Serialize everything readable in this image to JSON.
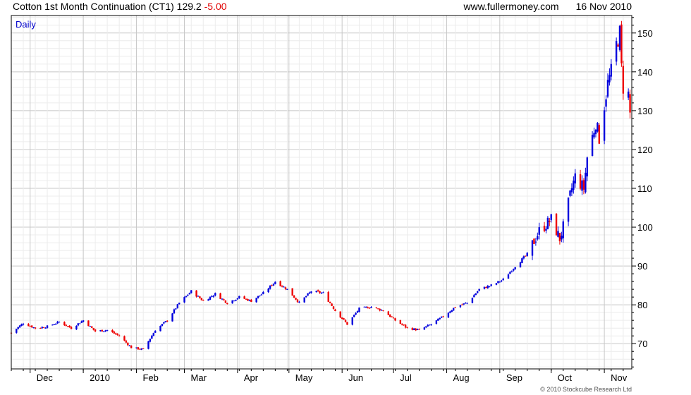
{
  "header": {
    "title": "Cotton 1st Month Continuation (CT1)",
    "last": "129.2",
    "change": "-5.00",
    "source": "www.fullermoney.com",
    "date": "16 Nov 2010"
  },
  "period_label": "Daily",
  "footer": {
    "copyright": "© 2010 Stockcube Research Ltd"
  },
  "colors": {
    "up": "#0000dd",
    "down": "#ee0000",
    "grid": "#d0d0d0",
    "frame": "#000000"
  },
  "chart_data": {
    "type": "candlestick",
    "x_range": [
      "2009-11-20",
      "2010-11-17"
    ],
    "ylim": [
      63.5,
      154.5
    ],
    "y_ticks": [
      70,
      80,
      90,
      100,
      110,
      120,
      130,
      140,
      150
    ],
    "x_ticks": [
      {
        "label": "Dec",
        "date": "2009-12-01"
      },
      {
        "label": "2010",
        "date": "2010-01-01"
      },
      {
        "label": "Feb",
        "date": "2010-02-01"
      },
      {
        "label": "Mar",
        "date": "2010-03-01"
      },
      {
        "label": "Apr",
        "date": "2010-04-01"
      },
      {
        "label": "May",
        "date": "2010-05-01"
      },
      {
        "label": "Jun",
        "date": "2010-06-01"
      },
      {
        "label": "Jul",
        "date": "2010-07-01"
      },
      {
        "label": "Aug",
        "date": "2010-08-01"
      },
      {
        "label": "Sep",
        "date": "2010-09-01"
      },
      {
        "label": "Oct",
        "date": "2010-10-01"
      },
      {
        "label": "Nov",
        "date": "2010-11-01"
      }
    ],
    "close_series": [
      [
        "2009-11-20",
        72.8
      ],
      [
        "2009-11-27",
        75.3
      ],
      [
        "2009-12-04",
        74.0
      ],
      [
        "2009-12-11",
        74.4
      ],
      [
        "2009-12-18",
        75.6
      ],
      [
        "2009-12-25",
        74.0
      ],
      [
        "2010-01-01",
        76.0
      ],
      [
        "2010-01-08",
        73.2
      ],
      [
        "2010-01-15",
        73.5
      ],
      [
        "2010-01-22",
        72.0
      ],
      [
        "2010-01-29",
        69.0
      ],
      [
        "2010-02-05",
        68.5
      ],
      [
        "2010-02-12",
        73.5
      ],
      [
        "2010-02-19",
        76.0
      ],
      [
        "2010-02-26",
        80.5
      ],
      [
        "2010-03-05",
        83.5
      ],
      [
        "2010-03-12",
        81.0
      ],
      [
        "2010-03-19",
        82.8
      ],
      [
        "2010-03-26",
        80.5
      ],
      [
        "2010-04-02",
        82.0
      ],
      [
        "2010-04-09",
        81.0
      ],
      [
        "2010-04-16",
        83.0
      ],
      [
        "2010-04-23",
        86.0
      ],
      [
        "2010-04-30",
        84.0
      ],
      [
        "2010-05-07",
        80.5
      ],
      [
        "2010-05-14",
        83.5
      ],
      [
        "2010-05-21",
        83.0
      ],
      [
        "2010-05-28",
        78.5
      ],
      [
        "2010-06-04",
        75.0
      ],
      [
        "2010-06-11",
        79.0
      ],
      [
        "2010-06-18",
        79.5
      ],
      [
        "2010-06-25",
        78.5
      ],
      [
        "2010-07-02",
        76.0
      ],
      [
        "2010-07-09",
        74.0
      ],
      [
        "2010-07-16",
        73.5
      ],
      [
        "2010-07-23",
        75.0
      ],
      [
        "2010-07-30",
        77.0
      ],
      [
        "2010-08-06",
        79.5
      ],
      [
        "2010-08-13",
        80.5
      ],
      [
        "2010-08-20",
        84.0
      ],
      [
        "2010-08-27",
        85.0
      ],
      [
        "2010-09-03",
        86.5
      ],
      [
        "2010-09-10",
        90.0
      ],
      [
        "2010-09-17",
        93.0
      ],
      [
        "2010-09-24",
        99.0
      ],
      [
        "2010-10-01",
        102.0
      ],
      [
        "2010-10-06",
        97.0
      ],
      [
        "2010-10-08",
        100.0
      ],
      [
        "2010-10-13",
        110.0
      ],
      [
        "2010-10-15",
        113.0
      ],
      [
        "2010-10-20",
        110.0
      ],
      [
        "2010-10-22",
        118.0
      ],
      [
        "2010-10-27",
        127.0
      ],
      [
        "2010-10-29",
        123.0
      ],
      [
        "2010-11-03",
        137.0
      ],
      [
        "2010-11-05",
        140.0
      ],
      [
        "2010-11-08",
        147.0
      ],
      [
        "2010-11-10",
        150.0
      ],
      [
        "2010-11-11",
        141.0
      ],
      [
        "2010-11-12",
        136.0
      ],
      [
        "2010-11-15",
        134.2
      ],
      [
        "2010-11-16",
        129.2
      ]
    ]
  }
}
